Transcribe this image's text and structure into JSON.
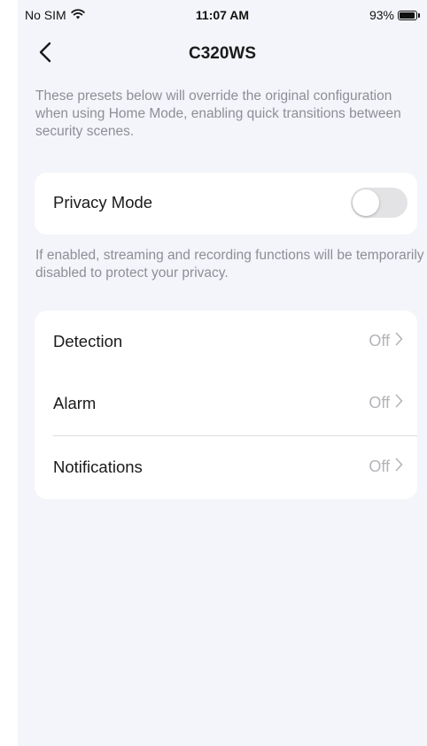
{
  "status_bar": {
    "carrier": "No SIM",
    "time": "11:07 AM",
    "battery": "93%"
  },
  "nav": {
    "title": "C320WS"
  },
  "intro": "These presets below will override the original configuration when using Home Mode, enabling quick transitions between security scenes.",
  "privacy": {
    "label": "Privacy Mode",
    "enabled": false,
    "note": "If enabled, streaming and recording functions will be temporarily disabled to protect your privacy."
  },
  "settings": [
    {
      "label": "Detection",
      "value": "Off"
    },
    {
      "label": "Alarm",
      "value": "Off"
    },
    {
      "label": "Notifications",
      "value": "Off"
    }
  ],
  "icons": {
    "back": "chevron-left-icon",
    "wifi": "wifi-icon",
    "battery": "battery-icon",
    "row_arrow": "chevron-right-icon"
  },
  "colors": {
    "background": "#f4f5fa",
    "card": "#ffffff",
    "secondary_text": "#8e8e96",
    "toggle_off": "#e3e3e6"
  }
}
